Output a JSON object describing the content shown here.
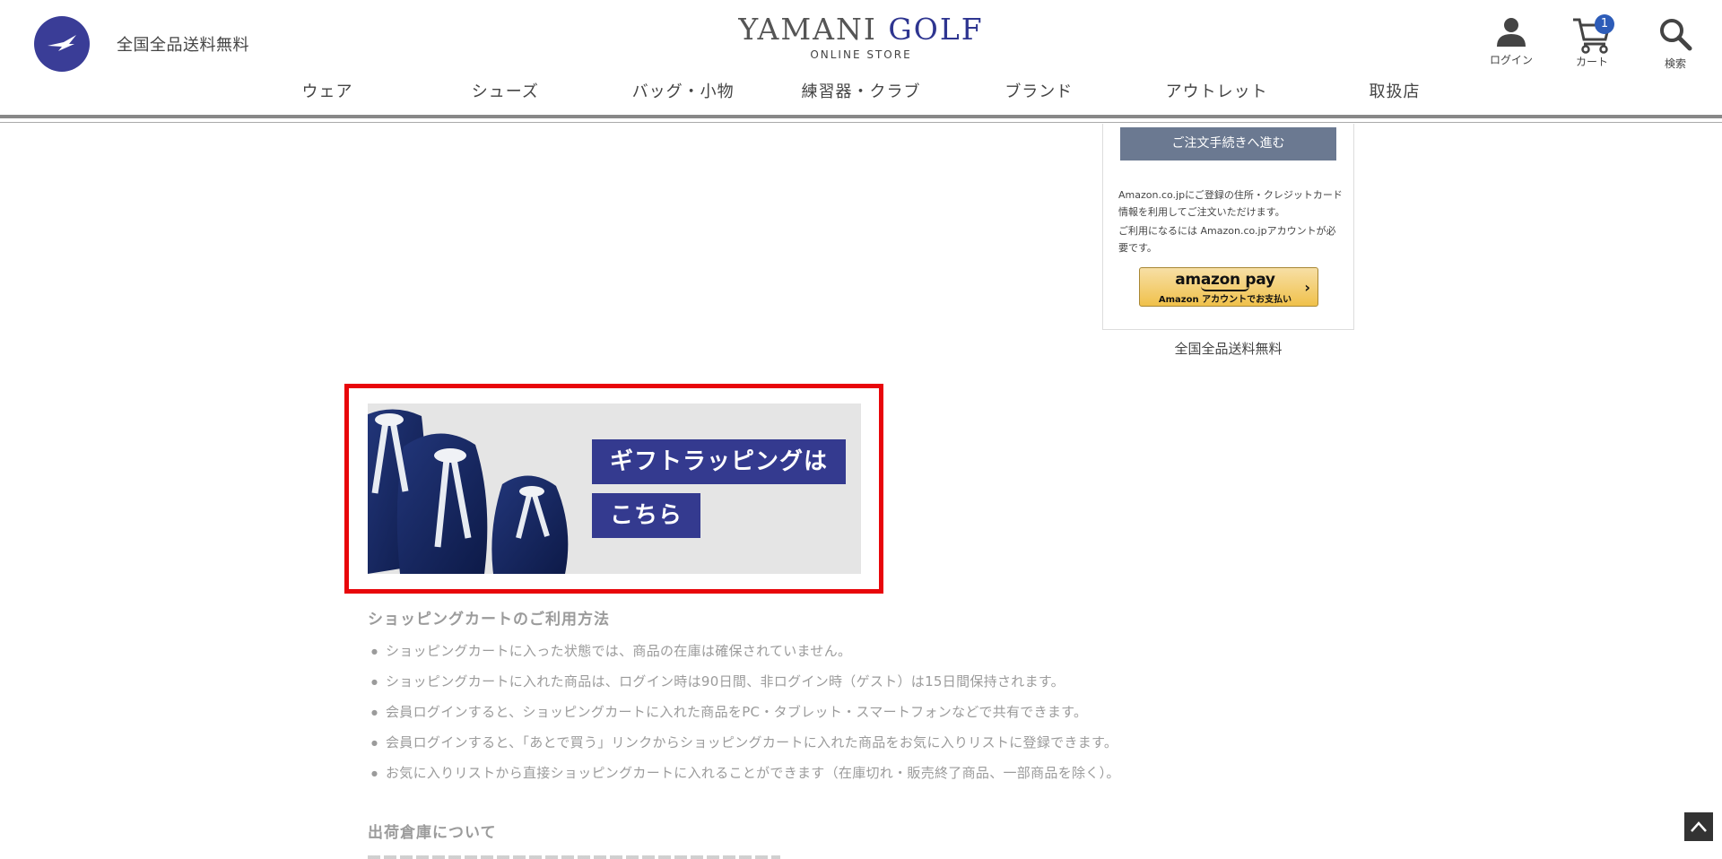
{
  "header": {
    "free_shipping": "全国全品送料無料",
    "brand_main": "YAMANI",
    "brand_golf": "GOLF",
    "brand_sub": "ONLINE STORE",
    "login_label": "ログイン",
    "cart_label": "カート",
    "cart_count": "1",
    "search_label": "検索",
    "accent_color": "#3a3d97"
  },
  "nav": {
    "items": [
      "ウェア",
      "シューズ",
      "バッグ・小物",
      "練習器・クラブ",
      "ブランド",
      "アウトレット",
      "取扱店"
    ]
  },
  "summary": {
    "checkout_button": "ご注文手続きへ進む",
    "amazon_text_1": "Amazon.co.jpにご登録の住所・クレジットカード情報を利用してご注文いただけます。",
    "amazon_text_2": "ご利用になるには Amazon.co.jpアカウントが必要です。",
    "amazon_pay_logo": "amazon pay",
    "amazon_pay_sub": "Amazon アカウントでお支払い",
    "free_shipping": "全国全品送料無料"
  },
  "gift_banner": {
    "line1": "ギフトラッピングは",
    "line2": "こちら",
    "highlight_color": "#e8060b"
  },
  "usage": {
    "title": "ショッピングカートのご利用方法",
    "items": [
      "ショッピングカートに入った状態では、商品の在庫は確保されていません。",
      "ショッピングカートに入れた商品は、ログイン時は90日間、非ログイン時（ゲスト）は15日間保持されます。",
      "会員ログインすると、ショッピングカートに入れた商品をPC・タブレット・スマートフォンなどで共有できます。",
      "会員ログインすると、「あとで買う」リンクからショッピングカートに入れた商品をお気に入りリストに登録できます。",
      "お気に入りリストから直接ショッピングカートに入れることができます（在庫切れ・販売終了商品、一部商品を除く）。"
    ],
    "warehouse_title": "出荷倉庫について"
  }
}
